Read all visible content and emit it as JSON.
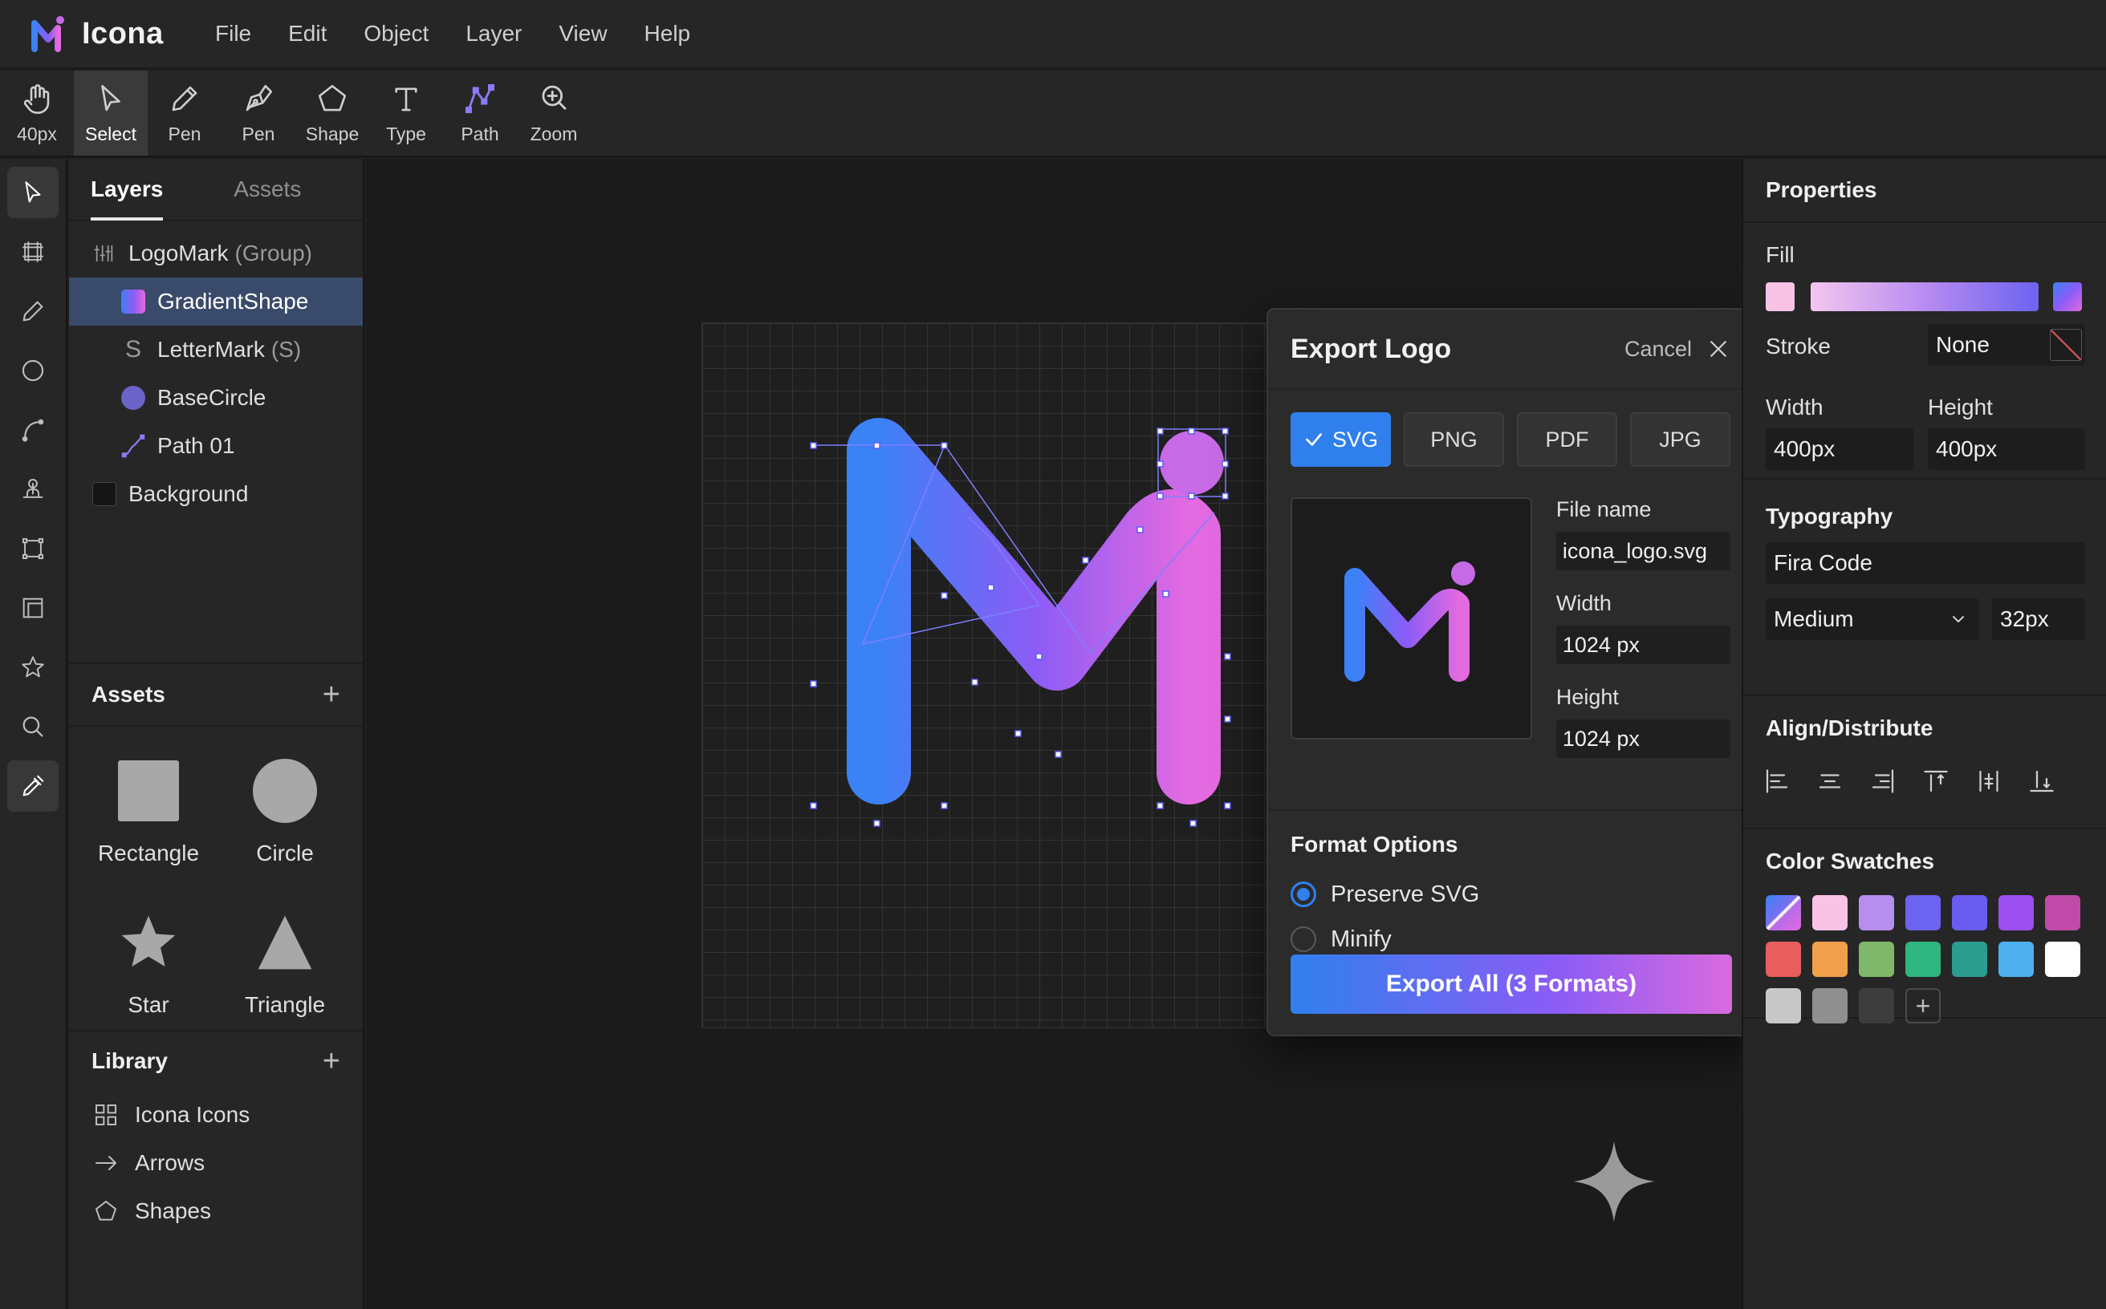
{
  "app": {
    "name": "Icona",
    "accent": "#2f80ed",
    "gradient_start": "#3b82f6",
    "gradient_mid": "#8b5cf6",
    "gradient_end": "#e36ae0"
  },
  "menu": [
    "File",
    "Edit",
    "Object",
    "Layer",
    "View",
    "Help"
  ],
  "toolbar": [
    {
      "label": "40px",
      "icon": "hand-icon"
    },
    {
      "label": "Select",
      "icon": "cursor-icon",
      "active": true
    },
    {
      "label": "Pen",
      "icon": "pencil-icon"
    },
    {
      "label": "Pen",
      "icon": "pen-nib-icon"
    },
    {
      "label": "Shape",
      "icon": "pentagon-icon"
    },
    {
      "label": "Type",
      "icon": "type-icon"
    },
    {
      "label": "Path",
      "icon": "path-icon"
    },
    {
      "label": "Zoom",
      "icon": "zoom-icon"
    }
  ],
  "left_tabs": [
    "Layers",
    "Assets"
  ],
  "layers": [
    {
      "name": "LogoMark",
      "sub": "(Group)",
      "icon": "group-icon"
    },
    {
      "name": "GradientShape",
      "sub": "",
      "icon": "gradient-swatch-icon",
      "selected": true
    },
    {
      "name": "LetterMark",
      "sub": "(S)",
      "icon": "letter-s-icon"
    },
    {
      "name": "BaseCircle",
      "sub": "",
      "icon": "circle-dot-icon"
    },
    {
      "name": "Path 01",
      "sub": "",
      "icon": "path-icon"
    },
    {
      "name": "Background",
      "sub": "",
      "icon": "dark-square-icon"
    }
  ],
  "assets": {
    "title": "Assets",
    "items": [
      "Rectangle",
      "Circle",
      "Star",
      "Triangle"
    ]
  },
  "library": {
    "title": "Library",
    "items": [
      "Icona Icons",
      "Arrows",
      "Shapes"
    ]
  },
  "export": {
    "title": "Export Logo",
    "cancel": "Cancel",
    "formats": [
      "SVG",
      "PNG",
      "PDF",
      "JPG"
    ],
    "file_name_label": "File name",
    "file_name": "icona_logo.svg",
    "width_label": "Width",
    "width": "1024 px",
    "height_label": "Height",
    "height": "1024 px",
    "options_title": "Format Options",
    "options": [
      "Preserve SVG",
      "Minify"
    ],
    "export_button": "Export All (3 Formats)"
  },
  "properties": {
    "title": "Properties",
    "fill_label": "Fill",
    "stroke_label": "Stroke",
    "stroke_value": "None",
    "width_label": "Width",
    "width_value": "400px",
    "height_label": "Height",
    "height_value": "400px",
    "typography_title": "Typography",
    "font": "Fira Code",
    "weight": "Medium",
    "size": "32px",
    "align_title": "Align/Distribute",
    "swatches_title": "Color Swatches",
    "swatches": [
      "#f9c3e6",
      "#b68ef0",
      "#6c63f0",
      "#6a5cf0",
      "#9b4ff0",
      "#c04aa8",
      "#e85d5d",
      "#f0a04b",
      "#7fb86a",
      "#2fb57f",
      "#2a9d8f",
      "#4fb0f0",
      "#ffffff",
      "#c8c8c8",
      "#8f8f8f",
      "#3d3d3d"
    ]
  }
}
